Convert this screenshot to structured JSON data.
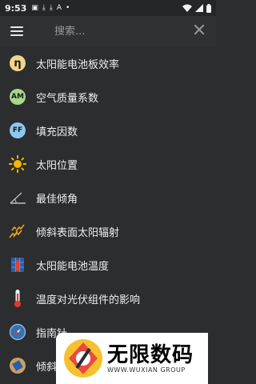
{
  "status": {
    "time": "9:53"
  },
  "search": {
    "placeholder": "搜索..."
  },
  "items": [
    {
      "label": "太阳能电池板效率",
      "icon": "eta-icon",
      "badge": "η"
    },
    {
      "label": "空气质量系数",
      "icon": "am-icon",
      "badge": "AM"
    },
    {
      "label": "填充因数",
      "icon": "ff-icon",
      "badge": "FF"
    },
    {
      "label": "太阳位置",
      "icon": "sun-icon"
    },
    {
      "label": "最佳倾角",
      "icon": "tilt-angle-icon"
    },
    {
      "label": "倾斜表面太阳辐射",
      "icon": "radiation-icon"
    },
    {
      "label": "太阳能电池温度",
      "icon": "solar-cell-icon"
    },
    {
      "label": "温度对光伏组件的影响",
      "icon": "thermometer-icon"
    },
    {
      "label": "指南针",
      "icon": "compass-icon"
    },
    {
      "label": "倾斜",
      "icon": "tilt-icon"
    }
  ],
  "watermark": {
    "title": "无限数码",
    "subtitle": "WWW.WUXIAN GROUP"
  }
}
